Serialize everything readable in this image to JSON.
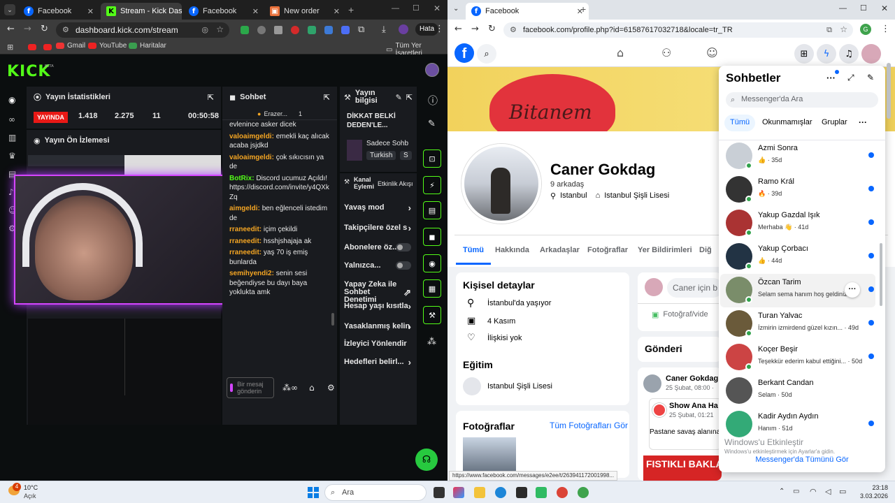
{
  "left_browser": {
    "tabs": [
      {
        "title": "Facebook",
        "icon": "facebook-icon"
      },
      {
        "title": "Stream - Kick Dashl",
        "icon": "kick-icon"
      },
      {
        "title": "Facebook",
        "icon": "facebook-icon"
      },
      {
        "title": "New order",
        "icon": "order-icon"
      }
    ],
    "url": "dashboard.kick.com/stream",
    "error_btn": "Hata",
    "bookmarks": [
      "Gmail",
      "YouTube",
      "Haritalar"
    ],
    "all_bookmarks": "Tüm Yer İşaretleri"
  },
  "kick": {
    "logo": "KICK",
    "beta": "BETA",
    "stats": {
      "title": "Yayın İstatistikleri",
      "live": "YAYINDA",
      "v1": "1.418",
      "v2": "2.275",
      "v3": "11",
      "time": "00:50:58"
    },
    "preview_title": "Yayın Ön İzlemesi",
    "chat": {
      "title": "Sohbet",
      "pinned_user": "Erazer...",
      "pinned_count": "1",
      "messages": [
        {
          "u": "",
          "t": "evlenince asker dicek"
        },
        {
          "u": "valoaimgeldi:",
          "t": "emekli kaç alıcak acaba jsjdkd"
        },
        {
          "u": "valoaimgeldi:",
          "t": "çok sıkıcısın ya de"
        },
        {
          "u": "BotRix:",
          "t": "Discord ucumuz Açıldı! https://discord.com/invite/y4QXkZq"
        },
        {
          "u": "aimgeldi:",
          "t": "ben eğlenceli istedim de"
        },
        {
          "u": "rraneedit:",
          "t": "içim çekildi"
        },
        {
          "u": "rraneedit:",
          "t": "hsshjshajaja ak"
        },
        {
          "u": "rraneedit:",
          "t": "yaş 70 iş emiş bunlarda"
        },
        {
          "u": "semihyendi2:",
          "t": "senin sesi beğendiyse bu dayı baya yoklukta amk"
        }
      ],
      "input_placeholder": "Bir mesaj gönderin"
    },
    "info": {
      "title": "Yayın bilgisi",
      "stream_title": "DİKKAT BELKİ DEDEN'LE...",
      "category": "Sadece Sohb",
      "tag1": "Turkish",
      "tag2": "S"
    },
    "actions": {
      "title": "Kanal Eylemi",
      "tab2": "Etkinlik Akışı",
      "items": [
        "Yavaş mod",
        "Takipçilere özel s",
        "Abonelere öz...",
        "Yalnızca...",
        "Yapay Zeka ile Sohbet Denetimi",
        "Hesap yaşı kısıtla",
        "Yasaklanmış kelin",
        "İzleyici Yönlendir",
        "Hedefleri belirl..."
      ]
    }
  },
  "right_browser": {
    "tab": "Facebook",
    "url": "facebook.com/profile.php?id=61587617032718&locale=tr_TR",
    "avatar_letter": "G",
    "status_url": "https://www.facebook.com/messages/e2ee/t/263941172001998..."
  },
  "fb": {
    "cover_text": "Bitanem",
    "name": "Caner Gokdag",
    "friends": "9 arkadaş",
    "city": "Istanbul",
    "school": "Istanbul Şişli Lisesi",
    "tabs": [
      "Tümü",
      "Hakkında",
      "Arkadaşlar",
      "Fotoğraflar",
      "Yer Bildirimleri",
      "Diğ"
    ],
    "details_title": "Kişisel detaylar",
    "details": [
      "İstanbul'da yaşıyor",
      "4 Kasım",
      "İlişkisi yok"
    ],
    "edu_title": "Eğitim",
    "edu_item": "Istanbul Şişli Lisesi",
    "photos_title": "Fotoğraflar",
    "photos_link": "Tüm Fotoğrafları Gör",
    "composer_placeholder": "Caner için b",
    "photo_video": "Fotoğraf/vide",
    "posts_title": "Gönderi",
    "post1_name": "Caner Gokdag",
    "post1_time": "25 Şubat, 08:00 ·",
    "post2_name": "Show Ana Ha",
    "post2_time": "25 Şubat, 01:21",
    "post2_text": "Pastane savaş alanına",
    "banner": "FISTIKLI BAKLAVA ALACAKTI, BURKANA DALDI"
  },
  "messenger": {
    "title": "Sohbetler",
    "search": "Messenger'da Ara",
    "filters": [
      "Tümü",
      "Okunmamışlar",
      "Gruplar"
    ],
    "conversations": [
      {
        "name": "Azmi Sonra",
        "sub": "👍 · 35d"
      },
      {
        "name": "Ramo Král",
        "sub": "🔥 · 39d"
      },
      {
        "name": "Yakup Gazdal Işık",
        "sub": "Merhaba 👋 · 41d"
      },
      {
        "name": "Yakup Çorbacı",
        "sub": "👍 · 44d"
      },
      {
        "name": "Özcan Tarim",
        "sub": "Selam sema hanım hoş geldiniz"
      },
      {
        "name": "Turan Yalvac",
        "sub": "İzmirin izmirdend güzel kızın... · 49d"
      },
      {
        "name": "Koçer Beşir",
        "sub": "Teşekkür ederim kabul ettiğini... · 50d"
      },
      {
        "name": "Berkant Candan",
        "sub": "Selam · 50d"
      },
      {
        "name": "Kadir Aydın Aydın",
        "sub": "Hanım · 51d"
      }
    ],
    "see_all": "Messenger'da Tümünü Gör",
    "activate": "Windows'u Etkinleştir",
    "activate_sub": "Windows'u etkinleştirmek için Ayarlar'a gidin."
  },
  "taskbar": {
    "temp": "10°C",
    "weather": "Açık",
    "badge": "4",
    "search": "Ara",
    "time": "23:18",
    "date": "3.03.2026"
  },
  "colors": {
    "kick_green": "#53fc18",
    "fb_blue": "#0866ff",
    "live_red": "#e91916"
  }
}
